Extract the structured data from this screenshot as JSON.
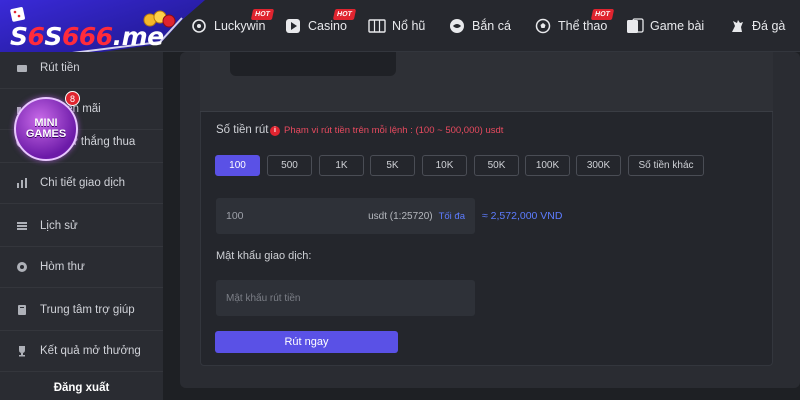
{
  "logo": {
    "prefix": "S",
    "six": "6",
    "mid": "S",
    "num": "666",
    "suffix": ".me"
  },
  "nav": [
    {
      "label": "Luckywin",
      "hot": "HOT",
      "icon": "luckywin-icon"
    },
    {
      "label": "Casino",
      "hot": "HOT",
      "icon": "casino-icon"
    },
    {
      "label": "Nổ hũ",
      "hot": "",
      "icon": "slot-icon"
    },
    {
      "label": "Bắn cá",
      "hot": "",
      "icon": "fish-icon"
    },
    {
      "label": "Thể thao",
      "hot": "HOT",
      "icon": "ball-icon"
    },
    {
      "label": "Game bài",
      "hot": "",
      "icon": "cards-icon"
    },
    {
      "label": "Đá gà",
      "hot": "",
      "icon": "rooster-icon"
    }
  ],
  "sidebar": {
    "items": [
      {
        "label": "Rút tiền",
        "icon": "withdraw-icon"
      },
      {
        "label": "Khuyến mãi",
        "icon": "gift-icon"
      },
      {
        "label": "Lịch sử thắng thua",
        "icon": "history-icon"
      },
      {
        "label": "Chi tiết giao dịch",
        "icon": "chart-icon"
      },
      {
        "label": "Lịch sử",
        "icon": "list-icon"
      },
      {
        "label": "Hòm thư",
        "icon": "mail-icon"
      },
      {
        "label": "Trung tâm trợ giúp",
        "icon": "help-icon"
      },
      {
        "label": "Kết quả mở thưởng",
        "icon": "trophy-icon"
      }
    ],
    "logout": "Đăng xuất"
  },
  "minigames": {
    "line1": "MINI",
    "line2": "GAMES",
    "count": "8"
  },
  "withdraw": {
    "amount_label": "Số tiền rút",
    "range_note": "Phạm vi rút tiền trên mỗi lệnh : (100 ~ 500,000) usdt",
    "chips": [
      "100",
      "500",
      "1K",
      "5K",
      "10K",
      "50K",
      "100K",
      "300K",
      "Số tiền khác"
    ],
    "active_chip": "100",
    "amount_value": "100",
    "unit": "usdt (1:25720)",
    "max_label": "Tối đa",
    "vnd_equivalent": "≈ 2,572,000 VND",
    "password_label": "Mật khẩu giao dịch:",
    "password_placeholder": "Mật khẩu rút tiền",
    "submit_label": "Rút ngay"
  },
  "colors": {
    "accent": "#5a51e6",
    "link": "#5d7cff",
    "hot": "#e0242f",
    "warning": "#e84a5f"
  }
}
